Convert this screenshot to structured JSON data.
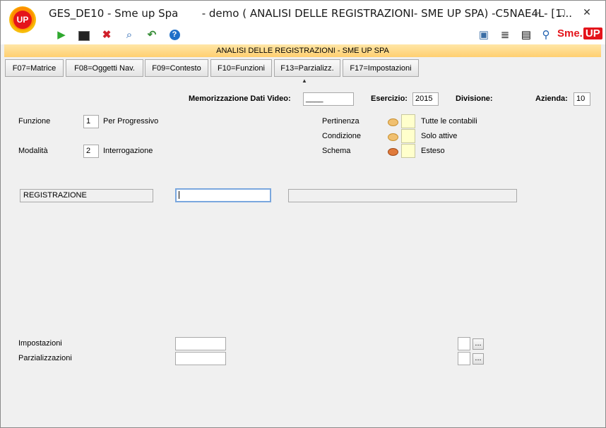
{
  "window": {
    "title": "GES_DE10 - Sme up Spa       - demo ( ANALISI DELLE REGISTRAZIONI- SME UP SPA) -C5NAE4L- [1...",
    "logo_text": "UP",
    "controls": {
      "minimize": "–",
      "maximize": "▢",
      "close": "✕"
    }
  },
  "toolbar": {
    "icons": [
      "play-icon",
      "terminal-icon",
      "close-icon",
      "search-icon",
      "back-arrow-icon",
      "help-icon"
    ],
    "right_icons": [
      "monitor-icon",
      "list-icon",
      "document-icon",
      "magnifier-icon"
    ],
    "brand_text": "Sme.",
    "brand_tag": "UP"
  },
  "header_bar": {
    "text": "ANALISI DELLE REGISTRAZIONI -  SME UP SPA"
  },
  "function_keys": [
    "F07=Matrice",
    "F08=Oggetti Nav.",
    "F09=Contesto",
    "F10=Funzioni",
    "F13=Parzializz.",
    "F17=Impostazioni"
  ],
  "info_row": {
    "memorizzazione_label": "Memorizzazione Dati Video:",
    "memorizzazione_value": "____",
    "esercizio_label": "Esercizio:",
    "esercizio_value": "2015",
    "divisione_label": "Divisione:",
    "azienda_label": "Azienda:",
    "azienda_value": "10"
  },
  "funzione": {
    "label": "Funzione",
    "value": "1",
    "description": "Per Progressivo"
  },
  "modalita": {
    "label": "Modalità",
    "value": "2",
    "description": "Interrogazione"
  },
  "options": [
    {
      "label": "Pertinenza",
      "description": "Tutte le contabili",
      "color": "#f0c070"
    },
    {
      "label": "Condizione",
      "description": "Solo attive",
      "color": "#f0c070"
    },
    {
      "label": "Schema",
      "description": "Esteso",
      "color": "#e07a3a"
    }
  ],
  "registrazione": {
    "label": "REGISTRAZIONE",
    "value": "",
    "description": ""
  },
  "bottom": {
    "impostazioni_label": "Impostazioni",
    "parzializzazioni_label": "Parzializzazioni",
    "dots_label": "..."
  }
}
